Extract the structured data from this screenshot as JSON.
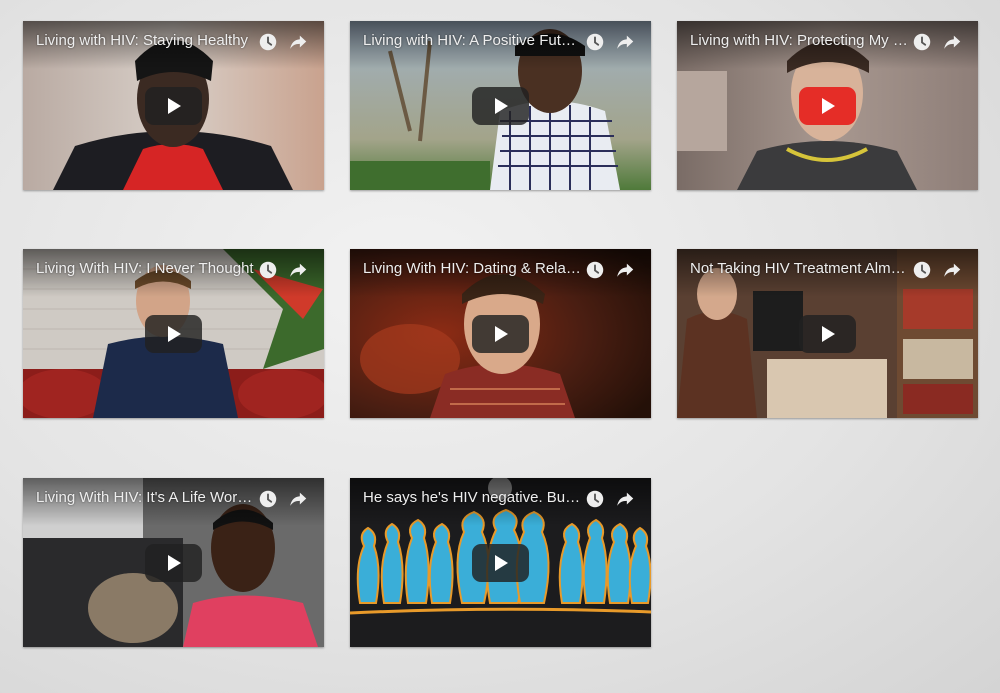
{
  "colors": {
    "play_default": "#212121",
    "play_active": "#e52d27"
  },
  "videos": [
    {
      "title": "Living with HIV: Staying Healthy",
      "icons": [
        "clock-icon",
        "share-icon"
      ],
      "play_button_color": "dark"
    },
    {
      "title": "Living with HIV: A Positive Future",
      "icons": [
        "clock-icon",
        "share-icon"
      ],
      "play_button_color": "dark"
    },
    {
      "title": "Living with HIV: Protecting My Partner",
      "icons": [
        "clock-icon",
        "share-icon"
      ],
      "play_button_color": "red"
    },
    {
      "title": "Living With HIV: I Never Thought",
      "icons": [
        "clock-icon",
        "share-icon"
      ],
      "play_button_color": "dark"
    },
    {
      "title": "Living With HIV: Dating & Relationships",
      "icons": [
        "clock-icon",
        "share-icon"
      ],
      "play_button_color": "dark"
    },
    {
      "title": "Not Taking HIV Treatment Almost",
      "icons": [
        "clock-icon",
        "share-icon"
      ],
      "play_button_color": "dark"
    },
    {
      "title": "Living With HIV: It's A Life Worth Living",
      "icons": [
        "clock-icon",
        "share-icon"
      ],
      "play_button_color": "dark"
    },
    {
      "title": "He says he's HIV negative. But ...",
      "icons": [
        "clock-icon",
        "share-icon"
      ],
      "play_button_color": "dark"
    }
  ]
}
